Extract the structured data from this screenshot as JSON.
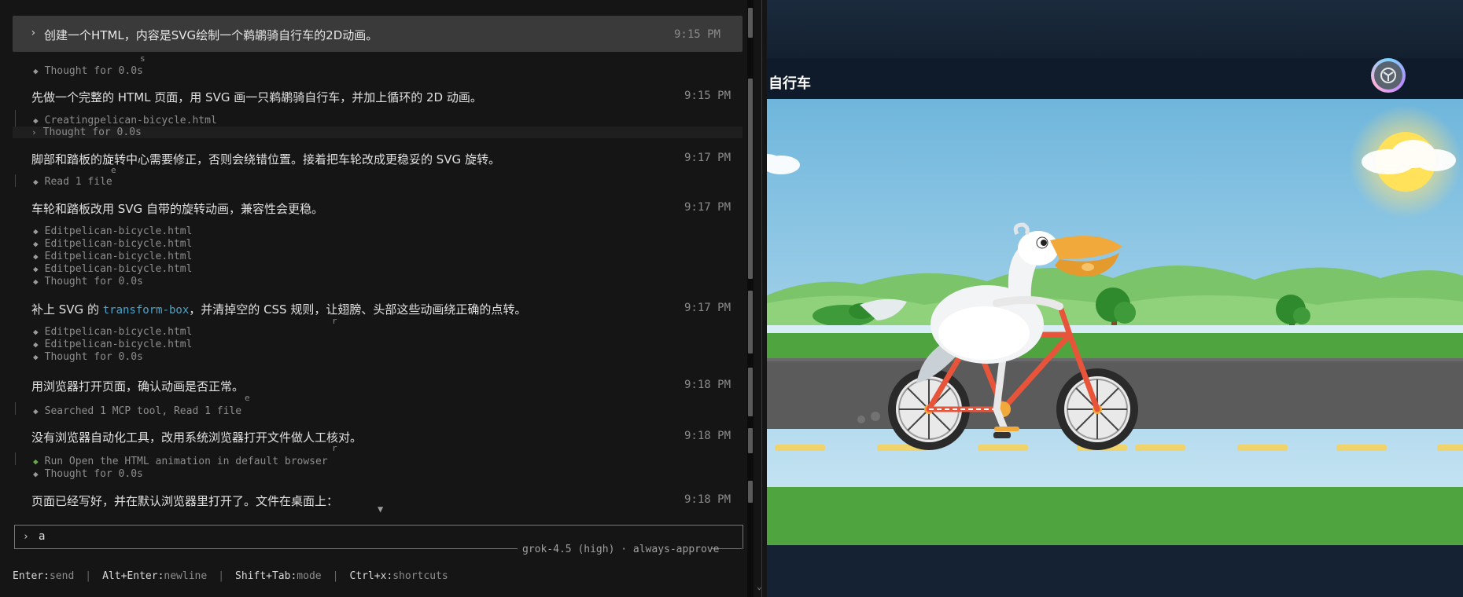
{
  "terminal": {
    "user_prompt": {
      "text": "创建一个HTML，内容是SVG绘制一个鹈鹕骑自行车的2D动画。",
      "time": "9:15 PM"
    },
    "step_thought_1": "Thought for 0.0s",
    "reply_1": {
      "text": "先做一个完整的 HTML 页面，用 SVG 画一只鹈鹕骑自行车，并加上循环的 2D 动画。",
      "time": "9:15 PM"
    },
    "step_creating": "Creatingpelican-bicycle.html",
    "step_thought_2": "Thought for 0.0s",
    "reply_2": {
      "text": "脚部和踏板的旋转中心需要修正，否则会绕错位置。接着把车轮改成更稳妥的 SVG 旋转。",
      "time": "9:17 PM"
    },
    "step_read": "Read 1 file",
    "reply_3": {
      "text": "车轮和踏板改用 SVG 自带的旋转动画，兼容性会更稳。",
      "time": "9:17 PM"
    },
    "step_edit_1": "Editpelican-bicycle.html",
    "step_edit_2": "Editpelican-bicycle.html",
    "step_edit_3": "Editpelican-bicycle.html",
    "step_edit_4": "Editpelican-bicycle.html",
    "step_thought_3": "Thought for 0.0s",
    "reply_4": {
      "prefix": "补上 SVG 的 ",
      "code": "transform-box",
      "suffix": "，并清掉空的 CSS 规则，让翅膀、头部这些动画绕正确的点转。",
      "time": "9:17 PM"
    },
    "step_edit_5": "Editpelican-bicycle.html",
    "step_edit_6": "Editpelican-bicycle.html",
    "step_thought_4": "Thought for 0.0s",
    "reply_5": {
      "text": "用浏览器打开页面，确认动画是否正常。",
      "time": "9:18 PM"
    },
    "step_searched": "Searched 1 MCP tool, Read 1 file",
    "reply_6": {
      "text": "没有浏览器自动化工具，改用系统浏览器打开文件做人工核对。",
      "time": "9:18 PM"
    },
    "step_run": "Run Open the HTML animation in default browser",
    "step_thought_5": "Thought for 0.0s",
    "reply_7": {
      "text": "页面已经写好，并在默认浏览器里打开了。文件在桌面上：",
      "time": "9:18 PM"
    },
    "stray_s": "s",
    "stray_e1": "e",
    "stray_r1": "r",
    "stray_e2": "e",
    "stray_r2": "r",
    "input_value": "a",
    "model": "grok-4.5 (high)",
    "mode": "always-approve",
    "footer": [
      {
        "key": "Enter",
        "action": "send"
      },
      {
        "key": "Alt+Enter",
        "action": "newline"
      },
      {
        "key": "Shift+Tab",
        "action": "mode"
      },
      {
        "key": "Ctrl+x",
        "action": "shortcuts"
      }
    ]
  },
  "browser": {
    "page_title": "自行车"
  },
  "colors": {
    "terminal_bg": "#151515",
    "user_msg_bg": "#3a3a3a",
    "accent_code": "#4aa3c9",
    "green_diamond": "#6aa84f",
    "bike_frame": "#e8543a",
    "beak": "#f2a93b",
    "sky_top": "#6fb6dc",
    "grass": "#4fa43f",
    "road": "#5b5b5b",
    "road_marking": "#f0d36a"
  }
}
